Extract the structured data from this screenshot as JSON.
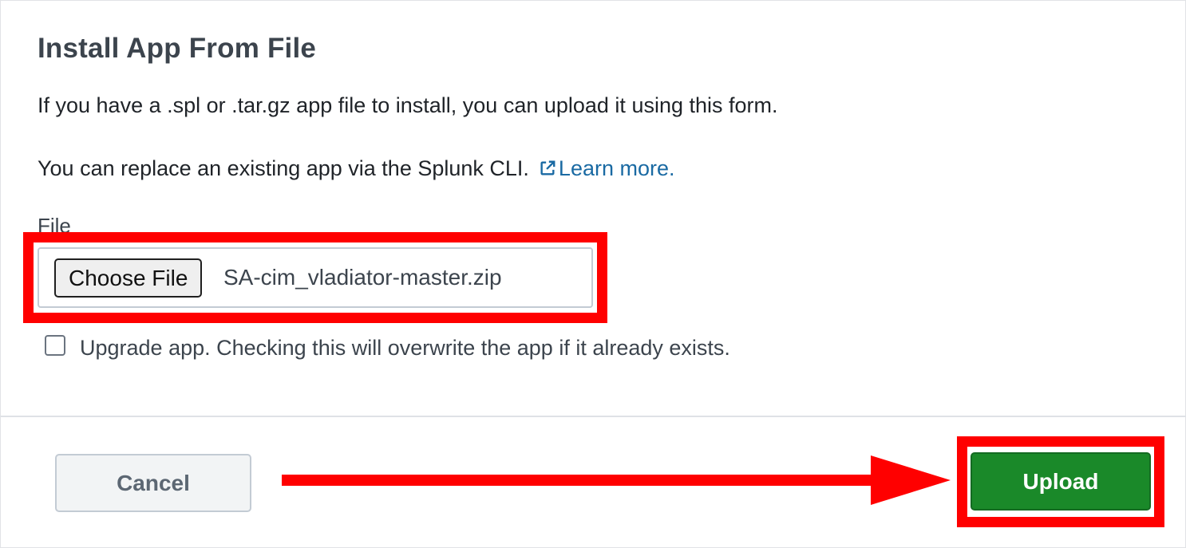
{
  "dialog": {
    "title": "Install App From File",
    "description_line1": "If you have a .spl or .tar.gz app file to install, you can upload it using this form.",
    "description_line2": "You can replace an existing app via the Splunk CLI.",
    "learn_more_label": "Learn more.",
    "learn_more_icon": "external-link-icon",
    "link_color": "#1a6aa3"
  },
  "file_input": {
    "label": "File",
    "button_label": "Choose File",
    "selected_file": "SA-cim_vladiator-master.zip"
  },
  "upgrade_option": {
    "checked": false,
    "label": "Upgrade app. Checking this will overwrite the app if it already exists."
  },
  "footer": {
    "cancel_label": "Cancel",
    "upload_label": "Upload",
    "upload_color": "#1a8929"
  },
  "annotations": {
    "highlight_color": "#ff0000"
  }
}
